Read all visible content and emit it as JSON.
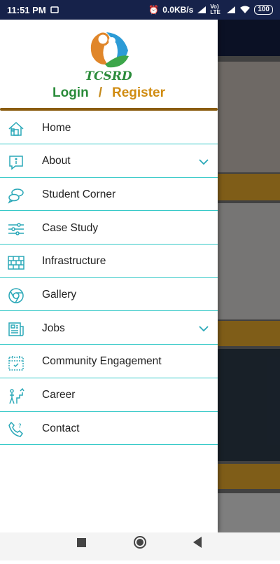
{
  "status_bar": {
    "time": "11:51 PM",
    "net_speed": "0.0KB/s",
    "volte": "Vo) LTE",
    "battery": "100"
  },
  "app": {
    "logo_text": "TCSRD"
  },
  "auth": {
    "login_label": "Login",
    "separator": "/",
    "register_label": "Register"
  },
  "menu": {
    "items": [
      {
        "label": "Home",
        "icon": "home-icon",
        "has_chevron": false
      },
      {
        "label": "About",
        "icon": "info-icon",
        "has_chevron": true
      },
      {
        "label": "Student Corner",
        "icon": "speech-bubbles-icon",
        "has_chevron": false
      },
      {
        "label": "Case Study",
        "icon": "sliders-icon",
        "has_chevron": false
      },
      {
        "label": "Infrastructure",
        "icon": "brick-wall-icon",
        "has_chevron": false
      },
      {
        "label": "Gallery",
        "icon": "chrome-icon",
        "has_chevron": false
      },
      {
        "label": "Jobs",
        "icon": "newspaper-icon",
        "has_chevron": true
      },
      {
        "label": "Community Engagement",
        "icon": "calendar-icon",
        "has_chevron": false
      },
      {
        "label": "Career",
        "icon": "career-ladder-icon",
        "has_chevron": false
      },
      {
        "label": "Contact",
        "icon": "phone-icon",
        "has_chevron": false
      }
    ]
  },
  "colors": {
    "accent": "#36c9c8",
    "login": "#2a8b3a",
    "register": "#d08c12",
    "status_bar": "#16224a"
  }
}
